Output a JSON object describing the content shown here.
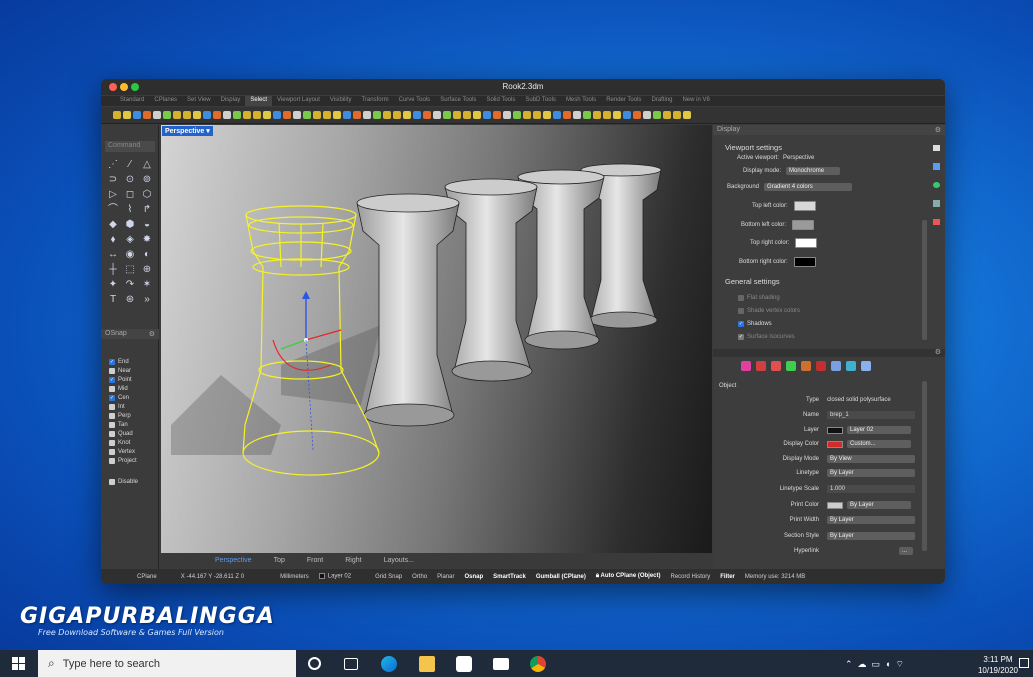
{
  "window": {
    "title": "Rook2.3dm"
  },
  "tabs": [
    "Standard",
    "CPlanes",
    "Set View",
    "Display",
    "Select",
    "Viewport Layout",
    "Visibility",
    "Transform",
    "Curve Tools",
    "Surface Tools",
    "Solid Tools",
    "SubD Tools",
    "Mesh Tools",
    "Render Tools",
    "Drafting",
    "New in V8"
  ],
  "active_tab": "Select",
  "left": {
    "command_placeholder": "Command",
    "osnap_title": "OSnap",
    "osnap_items": [
      {
        "label": "End",
        "checked": true
      },
      {
        "label": "Near",
        "checked": false
      },
      {
        "label": "Point",
        "checked": true
      },
      {
        "label": "Mid",
        "checked": false
      },
      {
        "label": "Cen",
        "checked": true
      },
      {
        "label": "Int",
        "checked": false
      },
      {
        "label": "Perp",
        "checked": false
      },
      {
        "label": "Tan",
        "checked": false
      },
      {
        "label": "Quad",
        "checked": false
      },
      {
        "label": "Knot",
        "checked": false
      },
      {
        "label": "Vertex",
        "checked": false
      },
      {
        "label": "Project",
        "checked": false
      }
    ],
    "disable_label": "Disable"
  },
  "viewport": {
    "name": "Perspective",
    "bottom_tabs": [
      "Perspective",
      "Top",
      "Front",
      "Right",
      "Layouts..."
    ]
  },
  "display_panel": {
    "header": "Display",
    "viewport_settings": "Viewport settings",
    "active_viewport_label": "Active viewport:",
    "active_viewport_value": "Perspective",
    "display_mode_label": "Display mode:",
    "display_mode_value": "Monochrome",
    "background_label": "Background",
    "background_value": "Gradient 4 colors",
    "top_left_label": "Top left color:",
    "bottom_left_label": "Bottom left color:",
    "top_right_label": "Top right color:",
    "bottom_right_label": "Bottom right color:",
    "colors": {
      "top_left": "#d8d8d8",
      "bottom_left": "#9a9a9a",
      "top_right": "#ffffff",
      "bottom_right": "#000000"
    },
    "general_settings": "General settings",
    "flat_shading": "Flat shading",
    "shade_vertex_colors": "Shade vertex colors",
    "shadows": "Shadows",
    "surface_isocurves": "Surface isocurves"
  },
  "properties_panel": {
    "section": "Object",
    "type_label": "Type",
    "type_value": "closed solid polysurface",
    "name_label": "Name",
    "name_value": "brep_1",
    "layer_label": "Layer",
    "layer_value": "Layer 02",
    "display_color_label": "Display Color",
    "display_color_value": "Custom...",
    "display_color_swatch": "#d42a2a",
    "display_mode_label": "Display Mode",
    "display_mode_value": "By View",
    "linetype_label": "Linetype",
    "linetype_value": "By Layer",
    "linetype_scale_label": "Linetype Scale",
    "linetype_scale_value": "1.000",
    "print_color_label": "Print Color",
    "print_color_value": "By Layer",
    "print_width_label": "Print Width",
    "print_width_value": "By Layer",
    "section_style_label": "Section Style",
    "section_style_value": "By Layer",
    "hyperlink_label": "Hyperlink",
    "hyperlink_button": "..."
  },
  "statusbar": {
    "cplane": "CPlane",
    "coords": "X -44.167 Y -28.611 Z 0",
    "units": "Millimeters",
    "layer": "Layer 02",
    "grid_snap": "Grid Snap",
    "ortho": "Ortho",
    "planar": "Planar",
    "osnap": "Osnap",
    "smarttrack": "SmartTrack",
    "gumball": "Gumball (CPlane)",
    "auto_cplane": "Auto CPlane (Object)",
    "record_history": "Record History",
    "filter": "Filter",
    "memory": "Memory use: 3214 MB"
  },
  "watermark": {
    "title": "GIGAPURBALINGGA",
    "subtitle": "Free Download Software & Games Full Version"
  },
  "taskbar": {
    "search_placeholder": "Type here to search",
    "time": "3:11 PM",
    "date": "10/19/2020"
  }
}
